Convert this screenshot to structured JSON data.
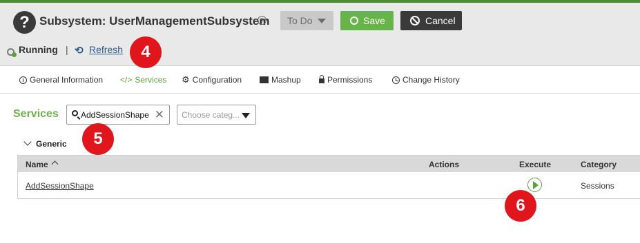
{
  "header": {
    "title": "Subsystem: UserManagementSubsystem",
    "info_glyph": "?",
    "help_glyph": "?",
    "status_value": "To Do",
    "save_label": "Save",
    "cancel_label": "Cancel"
  },
  "statusbar": {
    "running_label": "Running",
    "separator": "|",
    "refresh_label": "Refresh",
    "refresh_glyph": "⟲"
  },
  "tabs": [
    {
      "label": "General Information",
      "glyph": "i",
      "icon": "info-icon"
    },
    {
      "label": "Services",
      "glyph": "</>",
      "icon": "code-icon",
      "active": true
    },
    {
      "label": "Configuration",
      "glyph": "⚙",
      "icon": "gear-icon"
    },
    {
      "label": "Mashup",
      "icon": "mashup-icon"
    },
    {
      "label": "Permissions",
      "icon": "lock-icon"
    },
    {
      "label": "Change History",
      "icon": "clock-icon"
    }
  ],
  "services": {
    "heading": "Services",
    "search_value": "AddSessionShape",
    "clear_glyph": "✕",
    "category_placeholder": "Choose categ...",
    "group_label": "Generic",
    "columns": [
      "Name",
      "Actions",
      "Execute",
      "Category"
    ],
    "rows": [
      {
        "name": "AddSessionShape",
        "actions": "",
        "category": "Sessions"
      }
    ]
  },
  "annotations": [
    "4",
    "5",
    "6"
  ],
  "colors": {
    "accent_green": "#66b44a",
    "dark_button": "#3a3a3a",
    "badge_red": "#e0161c",
    "link_blue": "#2d5a8c"
  }
}
